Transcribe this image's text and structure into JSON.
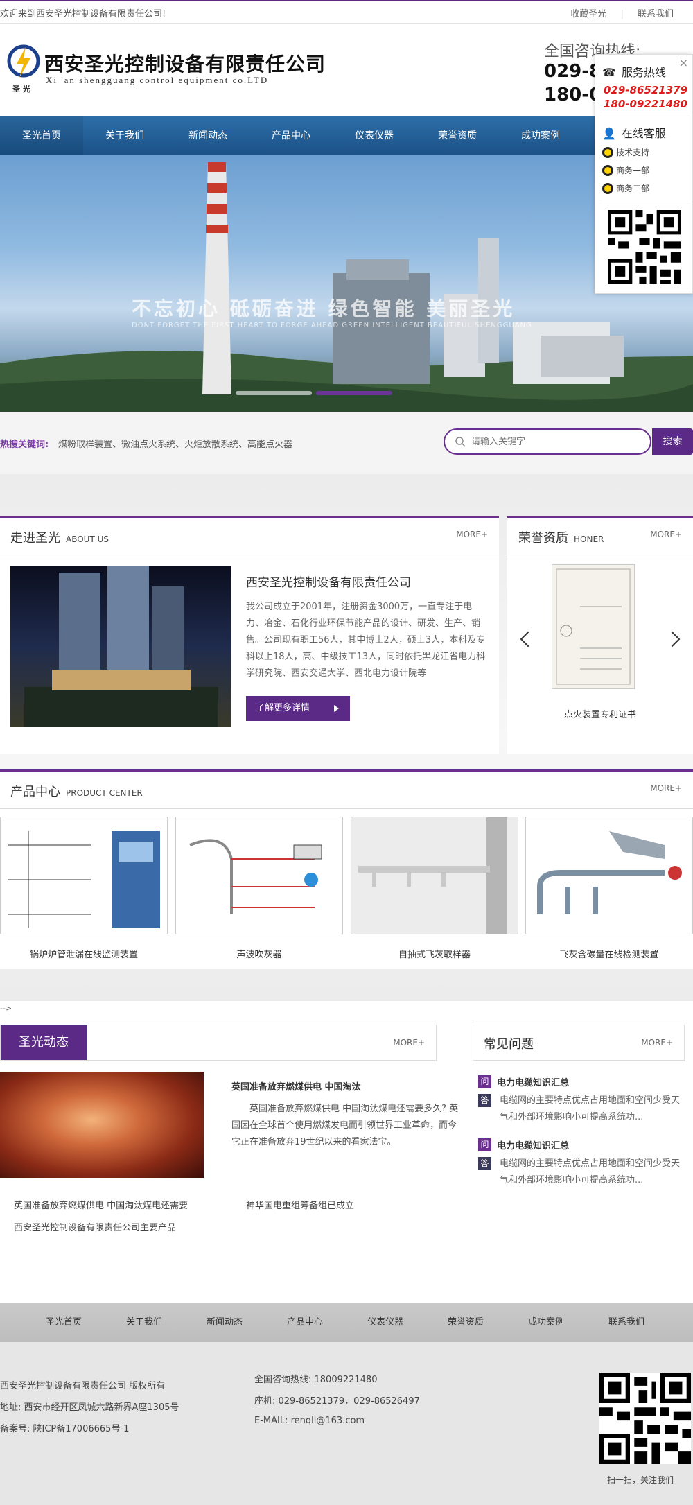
{
  "topbar": {
    "welcome": "欢迎来到西安圣光控制设备有限责任公司!",
    "links": [
      "收藏圣光",
      "|",
      "联系我们"
    ]
  },
  "header": {
    "company_cn": "西安圣光控制设备有限责任公司",
    "company_en": "Xi 'an shengguang control equipment co.LTD",
    "logo_sub": "圣 光",
    "hotline_label": "全国咨询热线:",
    "hotline_1": "029-8",
    "hotline_2": "180-0"
  },
  "nav": {
    "items": [
      "圣光首页",
      "关于我们",
      "新闻动态",
      "产品中心",
      "仪表仪器",
      "荣誉资质",
      "成功案例"
    ]
  },
  "banner": {
    "slogan": "不忘初心  砥砺奋进  绿色智能  美丽圣光",
    "slogan_en": "DONT FORGET THE FIRST HEART TO FORGE AHEAD GREEN INTELLIGENT BEAUTIFUL SHENGGUANG"
  },
  "float_panel": {
    "close": "×",
    "service_title": "服务热线",
    "phone_1": "029-86521379",
    "phone_2": "180-09221480",
    "online_title": "在线客服",
    "items": [
      "技术支持",
      "商务一部",
      "商务二部"
    ]
  },
  "keywords": {
    "label": "热搜关键词:",
    "list": "煤粉取样装置、微油点火系统、火炬放散系统、高能点火器",
    "placeholder": "请输入关键字",
    "button": "搜索"
  },
  "about": {
    "title": "走进圣光",
    "title_en": "ABOUT US",
    "more": "MORE+",
    "company": "西安圣光控制设备有限责任公司",
    "text": "我公司成立于2001年，注册资金3000万，一直专注于电力、冶金、石化行业环保节能产品的设计、研发、生产、销售。公司现有职工56人，其中博士2人，硕士3人，本科及专科以上18人，高、中级技工13人，同时依托黑龙江省电力科学研究院、西安交通大学、西北电力设计院等",
    "button": "了解更多详情"
  },
  "honor": {
    "title": "荣誉资质",
    "title_en": "HONER",
    "more": "MORE+",
    "caption": "点火装置专利证书"
  },
  "products": {
    "title": "产品中心",
    "title_en": "PRODUCT CENTER",
    "more": "MORE+",
    "items": [
      "锅炉炉管泄漏在线监测装置",
      "声波吹灰器",
      "自抽式飞灰取样器",
      "飞灰含碳量在线检测装置"
    ]
  },
  "comment_residue": "-->",
  "news": {
    "title": "圣光动态",
    "more": "MORE+",
    "headline": "英国准备放弃燃煤供电 中国淘汰",
    "summary": "英国准备放弃燃煤供电 中国淘汰煤电还需要多久? 英国因在全球首个使用燃煤发电而引领世界工业革命，而今它正在准备放弃19世纪以来的看家法宝。",
    "links": [
      "英国准备放弃燃煤供电 中国淘汰煤电还需要",
      "神华国电重组筹备组已成立",
      "西安圣光控制设备有限责任公司主要产品"
    ]
  },
  "faq": {
    "title": "常见问题",
    "more": "MORE+",
    "q_tag": "问",
    "a_tag": "答",
    "items": [
      {
        "q": "电力电缆知识汇总",
        "a": "电缆网的主要特点优点占用地面和空间少受天气和外部环境影响小可提高系统功..."
      },
      {
        "q": "电力电缆知识汇总",
        "a": "电缆网的主要特点优点占用地面和空间少受天气和外部环境影响小可提高系统功..."
      }
    ]
  },
  "footer": {
    "nav": [
      "圣光首页",
      "关于我们",
      "新闻动态",
      "产品中心",
      "仪表仪器",
      "荣誉资质",
      "成功案例",
      "联系我们"
    ],
    "copyright": "西安圣光控制设备有限责任公司 版权所有",
    "address": "地址:  西安市经开区凤城六路新界A座1305号",
    "icp": "备案号:  陕ICP备17006665号-1",
    "hotline": "全国咨询热线:  18009221480",
    "tel": "座机:  029-86521379，029-86526497",
    "email": "E-MAIL:      renqli@163.com",
    "qr_caption": "扫一扫，关注我们"
  },
  "colors": {
    "brand_purple": "#5b2a86",
    "nav_blue": "#1b5187",
    "hotline_red": "#e01a1a"
  }
}
